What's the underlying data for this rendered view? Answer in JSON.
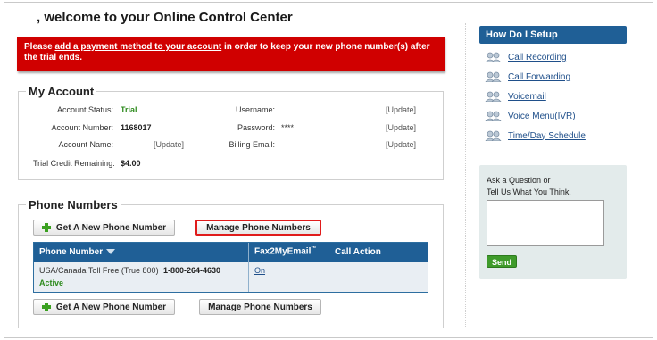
{
  "header": {
    "welcome": ", welcome to your Online Control Center"
  },
  "alert": {
    "prefix": "Please ",
    "link": "add a payment method to your account",
    "suffix": " in order to keep your new phone number(s) after the trial ends."
  },
  "account": {
    "legend": "My Account",
    "status_label": "Account Status:",
    "status_value": "Trial",
    "number_label": "Account Number:",
    "number_value": "1168017",
    "name_label": "Account Name:",
    "name_update": "[Update]",
    "credit_label": "Trial Credit Remaining:",
    "credit_value": "$4.00",
    "username_label": "Username:",
    "username_update": "[Update]",
    "password_label": "Password:",
    "password_value": "****",
    "password_update": "[Update]",
    "billing_label": "Billing Email:",
    "billing_update": "[Update]"
  },
  "phones": {
    "legend": "Phone Numbers",
    "get_new": "Get A New Phone Number",
    "manage": "Manage Phone Numbers",
    "columns": {
      "phone": "Phone Number",
      "fax": "Fax2MyEmail",
      "fax_tm": "™",
      "action": "Call Action"
    },
    "row": {
      "type": "USA/Canada Toll Free (True 800)",
      "number": "1-800-264-4630",
      "status": "Active",
      "fax": "On",
      "action": ""
    }
  },
  "sidebar": {
    "title": "How Do I Setup",
    "items": [
      {
        "label": "Call Recording",
        "icon": "people-icon"
      },
      {
        "label": "Call Forwarding",
        "icon": "people-icon"
      },
      {
        "label": "Voicemail",
        "icon": "people-icon"
      },
      {
        "label": "Voice Menu(IVR)",
        "icon": "people-icon"
      },
      {
        "label": "Time/Day Schedule",
        "icon": "people-icon"
      }
    ],
    "ask_line1": "Ask a Question or",
    "ask_line2": "Tell Us What You Think.",
    "send": "Send"
  },
  "colors": {
    "accent": "#1f5f96",
    "alert": "#d00000",
    "success": "#3f9b2b"
  }
}
